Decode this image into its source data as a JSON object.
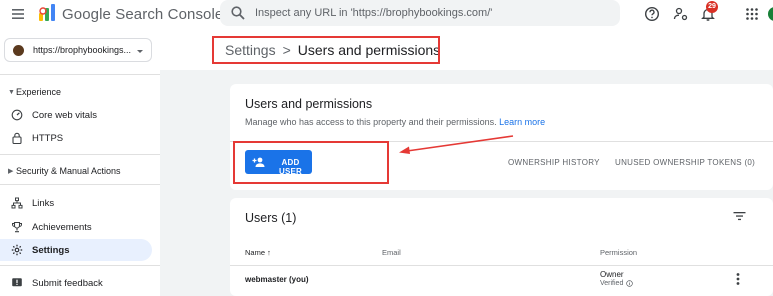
{
  "header": {
    "app_title": "Google Search Console",
    "search_placeholder": "Inspect any URL in 'https://brophybookings.com/'",
    "notifications_count": "29",
    "icons": [
      "menu-icon",
      "search-console-logo",
      "search-icon",
      "help-icon",
      "manage-accounts-icon",
      "notifications-icon",
      "apps-grid-icon"
    ],
    "accent_color": "#1a73e8",
    "badge_color": "#d93025"
  },
  "property": {
    "label": "https://brophybookings...",
    "caret_icon": "chevron-down-icon"
  },
  "breadcrumb": {
    "parent": "Settings",
    "separator": ">",
    "current": "Users and permissions"
  },
  "sidebar": {
    "sections": [
      {
        "label": "Experience",
        "expanded": true
      },
      {
        "label": "Security & Manual Actions",
        "expanded": false
      }
    ],
    "items": [
      {
        "label": "Core web vitals",
        "icon": "speed-gauge-icon"
      },
      {
        "label": "HTTPS",
        "icon": "lock-icon"
      },
      {
        "label": "Links",
        "icon": "sitemap-icon"
      },
      {
        "label": "Achievements",
        "icon": "trophy-icon"
      },
      {
        "label": "Settings",
        "icon": "settings-gear-icon",
        "active": true
      },
      {
        "label": "Submit feedback",
        "icon": "feedback-icon"
      }
    ],
    "active_color": "#e8f0fe"
  },
  "permissions_card": {
    "title": "Users and permissions",
    "subtitle": "Manage who has access to this property and their permissions.",
    "learn_more": "Learn more",
    "add_user": "ADD USER",
    "ownership_history": "OWNERSHIP HISTORY",
    "unused_tokens": "UNUSED OWNERSHIP TOKENS (0)"
  },
  "users_card": {
    "title": "Users (1)",
    "columns": {
      "name": "Name",
      "sort_indicator": "↑",
      "email": "Email",
      "permission": "Permission"
    },
    "rows": [
      {
        "name": "webmaster (you)",
        "email": "",
        "permission": "Owner",
        "status": "Verified"
      }
    ]
  },
  "annotation_color": "#e53935"
}
